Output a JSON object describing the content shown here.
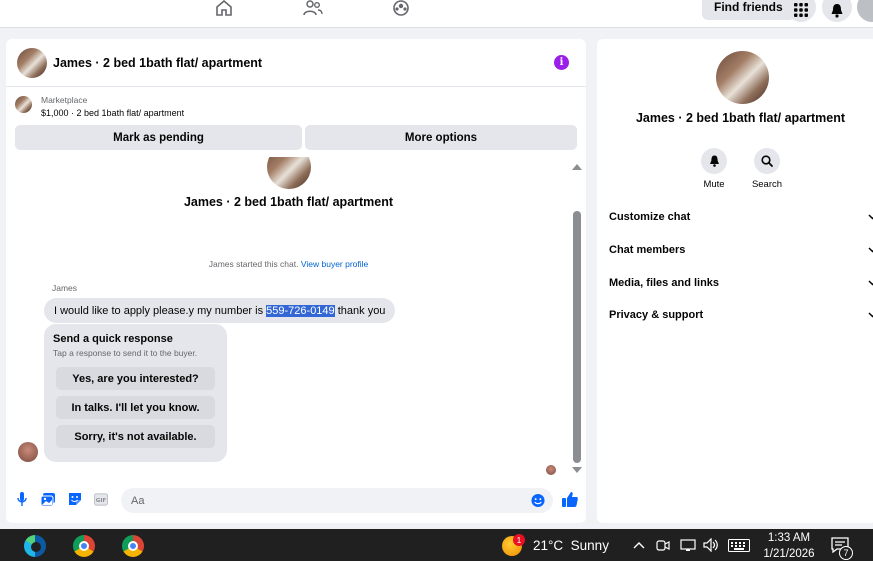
{
  "topbar": {
    "find_friends_label": "Find friends"
  },
  "chat": {
    "title": "James · 2 bed 1bath flat/ apartment",
    "marketplace_label": "Marketplace",
    "listing_summary": "$1,000 · 2 bed 1bath flat/ apartment",
    "mark_pending_label": "Mark as pending",
    "more_options_label": "More options",
    "conversation_title": "James · 2 bed 1bath flat/ apartment",
    "started_text": "James started this chat.",
    "view_profile_link": "View buyer profile",
    "sender_name": "James",
    "message_before": "I would like to apply please.y my number is ",
    "message_phone": "559-726-0149",
    "message_after": " thank you",
    "quick_response": {
      "title": "Send a quick response",
      "subtitle": "Tap a response to send it to the buyer.",
      "options": [
        "Yes, are you interested?",
        "In talks. I'll let you know.",
        "Sorry, it's not available."
      ]
    },
    "composer_placeholder": "Aa"
  },
  "right_panel": {
    "name": "James · 2 bed 1bath flat/ apartment",
    "actions": [
      {
        "label": "Mute",
        "icon": "bell-icon"
      },
      {
        "label": "Search",
        "icon": "search-icon"
      }
    ],
    "sections": [
      "Customize chat",
      "Chat members",
      "Media, files and links",
      "Privacy & support"
    ]
  },
  "taskbar": {
    "weather_alert_count": "1",
    "weather": "21°C  Sunny",
    "time": "1:33 AM",
    "date": "1/21/2026",
    "notification_count": "7"
  },
  "colors": {
    "accent_blue": "#0866ff",
    "info_purple": "#9b1fe8",
    "link_blue": "#0064d1",
    "highlight": "#3367d6"
  }
}
